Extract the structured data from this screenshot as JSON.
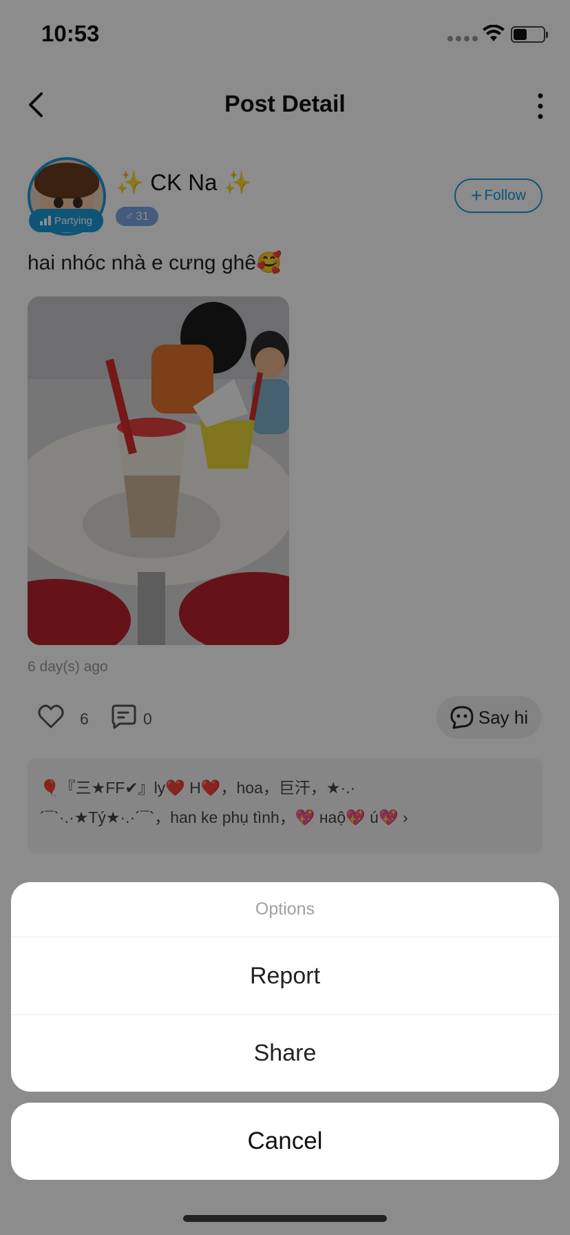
{
  "status_bar": {
    "time": "10:53",
    "battery_level": 0.45
  },
  "nav": {
    "title": "Post Detail",
    "back_icon": "chevron-left-icon",
    "more_icon": "more-vertical-icon"
  },
  "user": {
    "name": "CK Na",
    "spark_left": "✨",
    "spark_right": "✨",
    "status_badge": "Partying",
    "gender_symbol": "♂",
    "age": "31",
    "follow_label": "Follow",
    "follow_plus": "+"
  },
  "post": {
    "text": "hai nhóc nhà e cưng ghê🥰",
    "time": "6 day(s) ago",
    "likes": "6",
    "comments": "0",
    "sayhi_label": "Say hi"
  },
  "gifts": {
    "line1": "🎈『三★FF✔』ly❤️ H❤️，hoa，巨汗，★·.·",
    "line2": "´¯`·.·★Tý★·.·´¯`，han ke phụ tình，💖 нaộ💖 ú💖 ›"
  },
  "sheet": {
    "title": "Options",
    "items": [
      "Report",
      "Share"
    ],
    "cancel": "Cancel"
  },
  "colors": {
    "accent": "#1a9ad9",
    "overlay": "rgba(0,0,0,0.45)"
  }
}
